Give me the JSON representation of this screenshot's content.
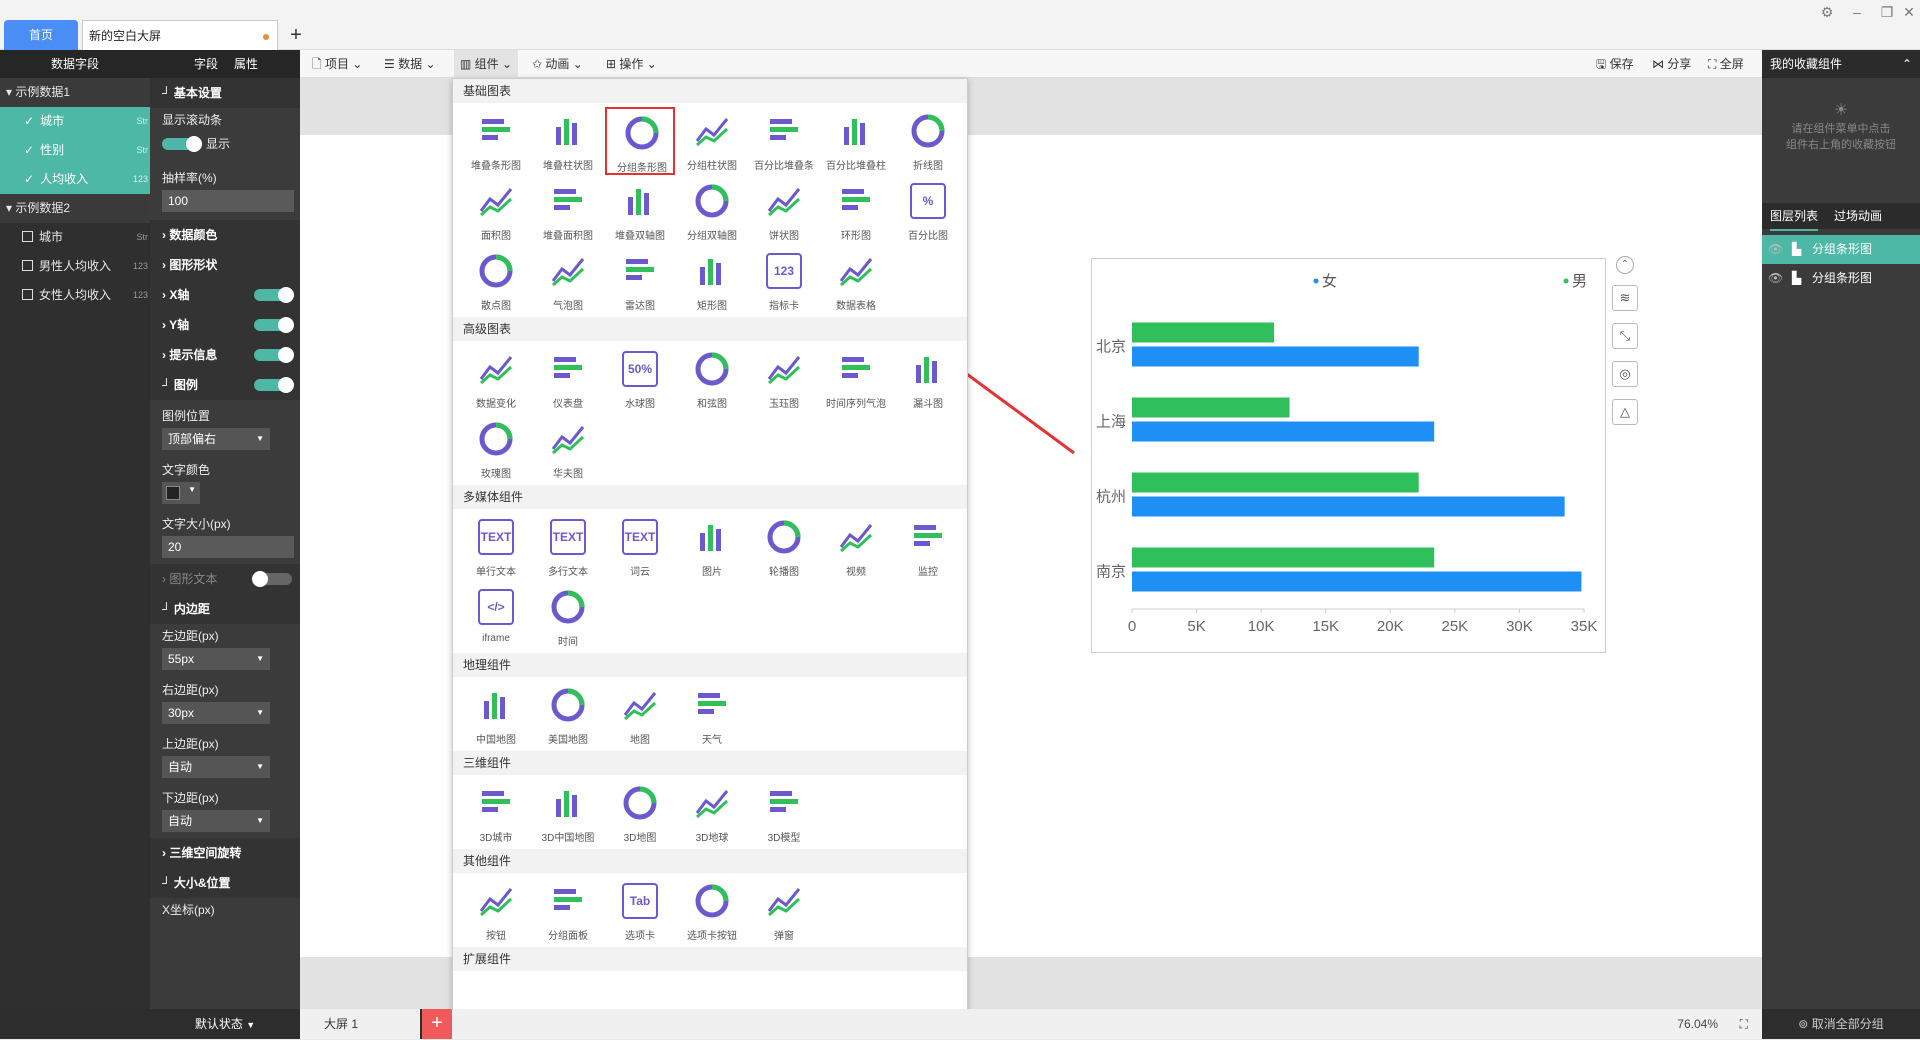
{
  "tabs": {
    "home": "首页",
    "document": "新的空白大屏",
    "add": "+"
  },
  "left_fields": {
    "header": "数据字段",
    "groups": [
      {
        "name": "示例数据1",
        "fields": [
          {
            "label": "城市",
            "type": "Str",
            "checked": true
          },
          {
            "label": "性别",
            "type": "Str",
            "checked": true
          },
          {
            "label": "人均收入",
            "type": "123",
            "checked": true
          }
        ]
      },
      {
        "name": "示例数据2",
        "fields": [
          {
            "label": "城市",
            "type": "Str",
            "checked": false
          },
          {
            "label": "男性人均收入",
            "type": "123",
            "checked": false
          },
          {
            "label": "女性人均收入",
            "type": "123",
            "checked": false
          }
        ]
      }
    ]
  },
  "props": {
    "tab_field": "字段",
    "tab_attr": "属性",
    "basic": "基本设置",
    "show_scroll": "显示滚动条",
    "show": "显示",
    "sample_rate": "抽样率(%)",
    "sample_value": "100",
    "data_color": "数据颜色",
    "shape": "图形形状",
    "x_axis": "X轴",
    "y_axis": "Y轴",
    "tooltip": "提示信息",
    "legend": "图例",
    "legend_pos": "图例位置",
    "legend_pos_value": "顶部偏右",
    "text_color": "文字颜色",
    "font_size": "文字大小(px)",
    "font_size_value": "20",
    "shape_text": "图形文本",
    "padding": "内边距",
    "left_pad": "左边距(px)",
    "left_pad_value": "55px",
    "right_pad": "右边距(px)",
    "right_pad_value": "30px",
    "top_pad": "上边距(px)",
    "top_pad_value": "自动",
    "bottom_pad": "下边距(px)",
    "bottom_pad_value": "自动",
    "rotate3d": "三维空间旋转",
    "size_pos": "大小&位置",
    "x_coord": "X坐标(px)"
  },
  "toolbar": {
    "project": "项目",
    "data": "数据",
    "component": "组件",
    "animation": "动画",
    "operation": "操作",
    "save": "保存",
    "share": "分享",
    "fullscreen": "全屏"
  },
  "dropdown": {
    "categories": [
      {
        "title": "基础图表",
        "items": [
          "堆叠条形图",
          "堆叠柱状图",
          "分组条形图",
          "分组柱状图",
          "百分比堆叠条",
          "百分比堆叠柱",
          "折线图",
          "面积图",
          "堆叠面积图",
          "堆叠双轴图",
          "分组双轴图",
          "饼状图",
          "环形图",
          "百分比图",
          "散点图",
          "气泡图",
          "雷达图",
          "矩形图",
          "指标卡",
          "数据表格"
        ]
      },
      {
        "title": "高级图表",
        "items": [
          "数据变化",
          "仪表盘",
          "水球图",
          "和弦图",
          "玉珏图",
          "时间序列气泡",
          "漏斗图",
          "玫瑰图",
          "华夫图"
        ]
      },
      {
        "title": "多媒体组件",
        "items": [
          "单行文本",
          "多行文本",
          "词云",
          "图片",
          "轮播图",
          "视频",
          "监控",
          "iframe",
          "时间"
        ]
      },
      {
        "title": "地理组件",
        "items": [
          "中国地图",
          "美国地图",
          "地图",
          "天气"
        ]
      },
      {
        "title": "三维组件",
        "items": [
          "3D城市",
          "3D中国地图",
          "3D地图",
          "3D地球",
          "3D模型"
        ]
      },
      {
        "title": "其他组件",
        "items": [
          "按钮",
          "分组面板",
          "选项卡",
          "选项卡按钮",
          "弹窗"
        ]
      },
      {
        "title": "扩展组件",
        "items": []
      }
    ],
    "icon_texts": {
      "metric": "123",
      "text": "TEXT",
      "tab": "Tab",
      "iframe": "</>",
      "percent": "%",
      "ball": "50%"
    }
  },
  "chart_data": {
    "type": "bar",
    "orientation": "horizontal",
    "categories": [
      "北京",
      "上海",
      "杭州",
      "南京"
    ],
    "series": [
      {
        "name": "男",
        "color": "#2fbf5b",
        "values": [
          11000,
          12200,
          22200,
          23400
        ]
      },
      {
        "name": "女",
        "color": "#1e8ff5",
        "values": [
          22200,
          23400,
          33500,
          34800
        ]
      }
    ],
    "xticks": [
      "0",
      "5K",
      "10K",
      "15K",
      "20K",
      "25K",
      "30K",
      "35K"
    ],
    "xlim": [
      0,
      35000
    ],
    "legend": {
      "placement": "top",
      "entries": [
        "女",
        "男"
      ]
    }
  },
  "right_panel": {
    "favorites": "我的收藏组件",
    "fav_hint_1": "请在组件菜单中点击",
    "fav_hint_2": "组件右上角的收藏按钮",
    "tab_layers": "图层列表",
    "tab_transition": "过场动画",
    "layers": [
      "分组条形图",
      "分组条形图"
    ]
  },
  "bottom": {
    "state": "默认状态",
    "screen": "大屏 1",
    "zoom": "76.04%",
    "ungroup": "取消全部分组"
  },
  "colors": {
    "accent": "#4db8a6",
    "primary": "#4a8ef5",
    "icon": "#6a5acd",
    "highlight": "#e53333"
  }
}
